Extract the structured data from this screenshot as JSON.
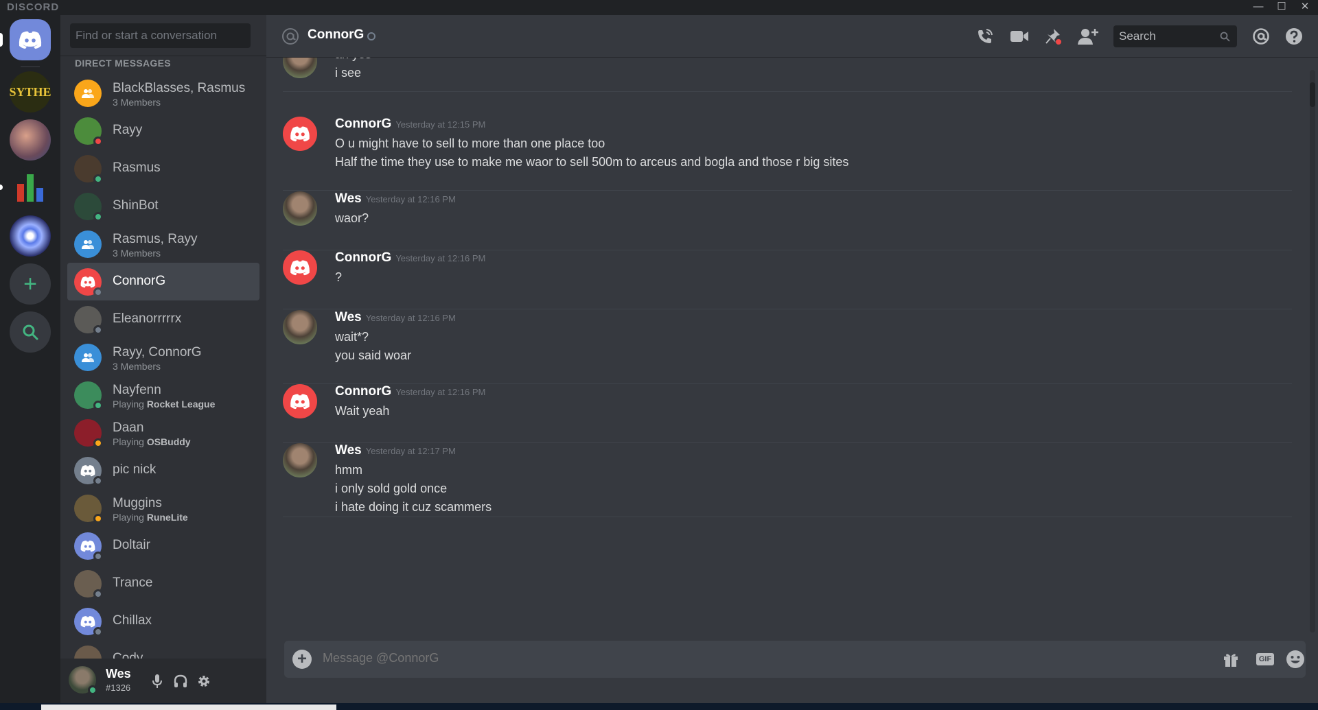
{
  "window": {
    "brand": "DISCORD",
    "min": "—",
    "max": "☐",
    "close": "✕"
  },
  "servers": [
    {
      "name": "Discord Home",
      "kind": "home"
    },
    {
      "name": "Sythe",
      "label": "SYTHE",
      "bg": "#2b2d12"
    },
    {
      "name": "Server avatar",
      "bg": "#8a6a5a"
    },
    {
      "name": "Chart server",
      "bg": "#1f3b28"
    },
    {
      "name": "Compass server",
      "bg": "#3e4a9e"
    },
    {
      "name": "Add a Server",
      "icon": "plus-icon"
    },
    {
      "name": "Server Discovery",
      "icon": "search-icon"
    }
  ],
  "sidebar": {
    "search_placeholder": "Find or start a conversation",
    "dm_header": "DIRECT MESSAGES",
    "dms": [
      {
        "name": "BlackBlasses, Rasmus",
        "sub": "3 Members",
        "type": "group",
        "color": "#faa61a"
      },
      {
        "name": "Rayy",
        "status": "#f04747",
        "color": "#4c8c3c"
      },
      {
        "name": "Rasmus",
        "status": "#43b581",
        "color": "#4a3b2e"
      },
      {
        "name": "ShinBot",
        "status": "#43b581",
        "color": "#2c4a3a"
      },
      {
        "name": "Rasmus, Rayy",
        "sub": "3 Members",
        "type": "group",
        "color": "#3a8fd8"
      },
      {
        "name": "ConnorG",
        "status": "#747f8d",
        "color": "#f04747",
        "active": true
      },
      {
        "name": "Eleanorrrrrx",
        "status": "#747f8d",
        "color": "#5b5a57"
      },
      {
        "name": "Rayy, ConnorG",
        "sub": "3 Members",
        "type": "group",
        "color": "#3a8fd8"
      },
      {
        "name": "Nayfenn",
        "sub_prefix": "Playing ",
        "sub_bold": "Rocket League",
        "status": "#43b581",
        "color": "#3c8c5c"
      },
      {
        "name": "Daan",
        "sub_prefix": "Playing ",
        "sub_bold": "OSBuddy",
        "status": "#faa61a",
        "color": "#8c1e2a"
      },
      {
        "name": "pic nick",
        "status": "#747f8d",
        "color": "#747f8d"
      },
      {
        "name": "Muggins",
        "sub_prefix": "Playing ",
        "sub_bold": "RuneLite",
        "status": "#faa61a",
        "color": "#6a5a3a"
      },
      {
        "name": "Doltair",
        "status": "#747f8d",
        "color": "#7289da"
      },
      {
        "name": "Trance",
        "status": "#747f8d",
        "color": "#6a5e50"
      },
      {
        "name": "Chillax",
        "status": "#747f8d",
        "color": "#7289da"
      },
      {
        "name": "Cody",
        "status": "#747f8d",
        "color": "#6a5a4a",
        "partial": true
      }
    ]
  },
  "user": {
    "name": "Wes",
    "tag": "#1326"
  },
  "header": {
    "at": "@",
    "name": "ConnorG",
    "search": "Search"
  },
  "messages": [
    {
      "author": "",
      "time": "",
      "avatar": "wes",
      "lines": [
        "ah yes",
        "i see"
      ]
    },
    {
      "author": "ConnorG",
      "time": "Yesterday at 12:15 PM",
      "avatar": "discord",
      "lines": [
        "O u might have to sell to more than one place too",
        "Half the time they use to make me waor to sell 500m to arceus and bogla and those r big sites"
      ]
    },
    {
      "author": "Wes",
      "time": "Yesterday at 12:16 PM",
      "avatar": "wes",
      "lines": [
        "waor?"
      ]
    },
    {
      "author": "ConnorG",
      "time": "Yesterday at 12:16 PM",
      "avatar": "discord",
      "lines": [
        "?"
      ]
    },
    {
      "author": "Wes",
      "time": "Yesterday at 12:16 PM",
      "avatar": "wes",
      "lines": [
        "wait*?",
        "you said woar"
      ]
    },
    {
      "author": "ConnorG",
      "time": "Yesterday at 12:16 PM",
      "avatar": "discord",
      "lines": [
        "Wait yeah"
      ]
    },
    {
      "author": "Wes",
      "time": "Yesterday at 12:17 PM",
      "avatar": "wes",
      "lines": [
        "hmm",
        "i only sold gold once",
        "i hate doing it cuz scammers"
      ]
    }
  ],
  "composer": {
    "placeholder": "Message @ConnorG",
    "gif": "GIF"
  }
}
